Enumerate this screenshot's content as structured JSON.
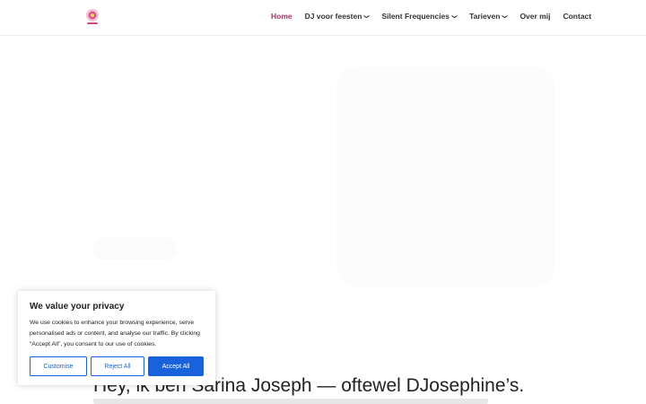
{
  "header": {
    "logo_icon": "djosephines-logo-icon",
    "nav": [
      {
        "label": "Home",
        "active": true,
        "dropdown": false
      },
      {
        "label": "DJ voor feesten",
        "active": false,
        "dropdown": true
      },
      {
        "label": "Silent Frequencies",
        "active": false,
        "dropdown": true
      },
      {
        "label": "Tarieven",
        "active": false,
        "dropdown": true
      },
      {
        "label": "Over mij",
        "active": false,
        "dropdown": false
      },
      {
        "label": "Contact",
        "active": false,
        "dropdown": false
      }
    ],
    "accent_color": "#a6326b"
  },
  "main": {
    "headline": "Hey, ik ben Sarina Joseph — oftewel DJosephine’s."
  },
  "cookie_banner": {
    "title": "We value your privacy",
    "text": "We use cookies to enhance your browsing experience, serve personalised ads or content, and analyse our traffic. By clicking “Accept All”, you consent to our use of cookies.",
    "customise_label": "Customise",
    "reject_label": "Reject All",
    "accept_label": "Accept All",
    "button_color": "#1863dc"
  }
}
